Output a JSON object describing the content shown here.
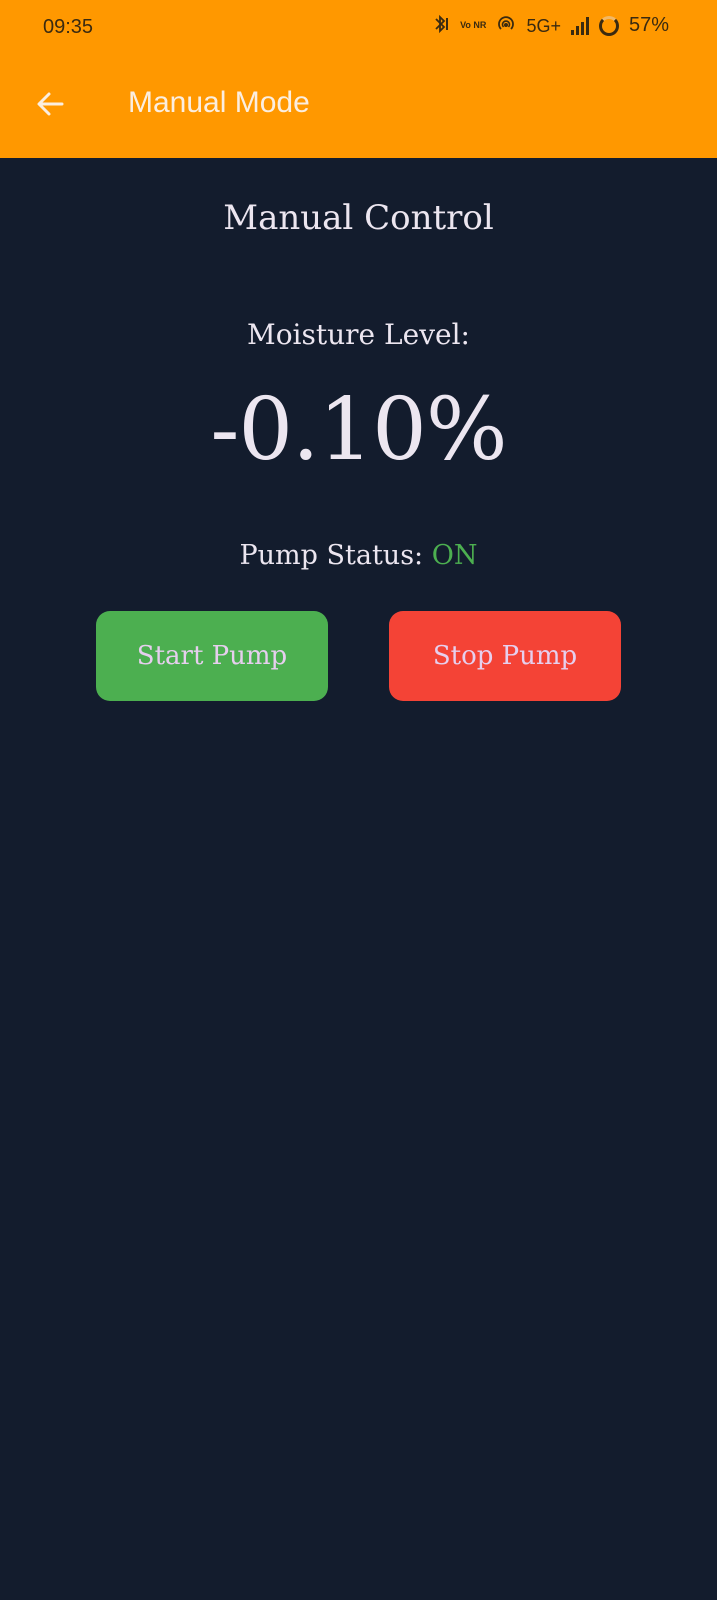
{
  "status_bar": {
    "time": "09:35",
    "network": "5G+",
    "vonr": "Vo NR",
    "battery": "57%",
    "icons": [
      "bluetooth-icon",
      "vonr-icon",
      "hotspot-icon",
      "signal-icon",
      "battery-icon"
    ]
  },
  "appbar": {
    "title": "Manual Mode",
    "color": "#ff9800"
  },
  "main": {
    "heading": "Manual Control",
    "moisture_label": "Moisture Level:",
    "moisture_value": "-0.10%",
    "pump_status_label": "Pump Status:",
    "pump_status_value": "ON",
    "pump_status_color": "#4caf50",
    "start_button_label": "Start Pump",
    "start_button_color": "#4caf50",
    "stop_button_label": "Stop Pump",
    "stop_button_color": "#f44336"
  },
  "colors": {
    "background": "#131c2d",
    "text": "#ece6f0"
  }
}
